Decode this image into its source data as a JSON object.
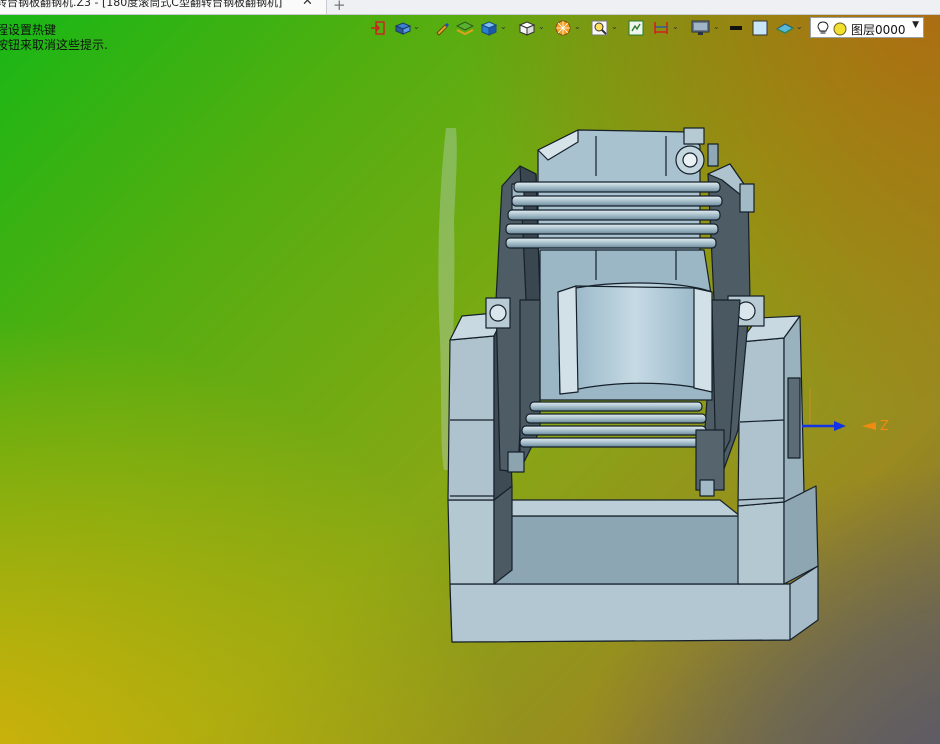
{
  "tab": {
    "title": "转台钢板翻钢机.Z3 - [180度滚筒式C型翻转台钢板翻钢机]",
    "close_glyph": "✕",
    "add_glyph": "+"
  },
  "hints": {
    "line1": "程设置热键",
    "line2": "按钮来取消这些提示."
  },
  "toolbar": {
    "icons": [
      "exit-sketch-icon",
      "view-orientation-icon",
      "pen-icon",
      "layer-stack-icon",
      "solid-box-icon",
      "wireframe-cube-icon",
      "color-wheel-icon",
      "zoom-icon",
      "fit-view-icon",
      "dimension-icon",
      "display-monitor-icon",
      "line-style-icon",
      "fill-color-icon",
      "surface-icon"
    ],
    "layer": {
      "value": "图层0000",
      "icons": [
        "lightbulb-icon",
        "yellow-circle-icon"
      ]
    }
  },
  "triad": {
    "axis_label": "Z"
  },
  "colors": {
    "model_face": "#a9c2cf",
    "model_edge": "#15202a",
    "triad_z": "#1432e6",
    "triad_label": "#f08a10"
  }
}
